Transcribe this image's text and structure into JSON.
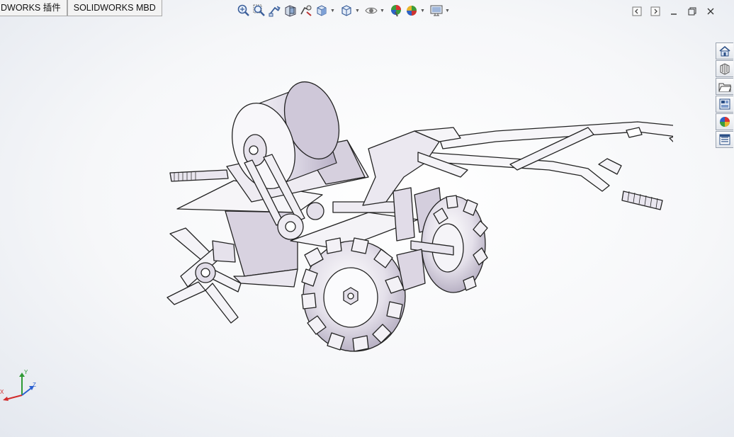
{
  "tabs": [
    {
      "label": "DWORKS 插件"
    },
    {
      "label": "SOLIDWORKS MBD"
    }
  ],
  "heads_up_toolbar": [
    {
      "icon": "zoom-to-fit-icon",
      "caret": false
    },
    {
      "icon": "zoom-to-area-icon",
      "caret": false
    },
    {
      "icon": "previous-view-icon",
      "caret": false
    },
    {
      "icon": "section-view-icon",
      "caret": false
    },
    {
      "icon": "dynamic-annotation-views-icon",
      "caret": false
    },
    {
      "icon": "view-orientation-icon",
      "caret": true
    },
    {
      "icon": "display-style-icon",
      "caret": true
    },
    {
      "icon": "hide-show-items-icon",
      "caret": true
    },
    {
      "icon": "edit-appearance-icon",
      "caret": false
    },
    {
      "icon": "apply-scene-icon",
      "caret": true
    },
    {
      "icon": "view-settings-icon",
      "caret": true
    }
  ],
  "window_controls": [
    "tile-left-icon",
    "tile-right-icon",
    "minimize-icon",
    "restore-icon",
    "close-icon"
  ],
  "task_pane": [
    "solidworks-resources-icon",
    "design-library-icon",
    "file-explorer-icon",
    "view-palette-icon",
    "appearances-scenes-icon",
    "custom-properties-icon"
  ],
  "triad": {
    "x_label": "X",
    "y_label": "Y",
    "z_label": "Z"
  },
  "colors": {
    "model_face": "#e8e6ee",
    "model_edge": "#222222",
    "axis_x": "#d22b2b",
    "axis_y": "#2f9a35",
    "axis_z": "#2a5fd0"
  }
}
